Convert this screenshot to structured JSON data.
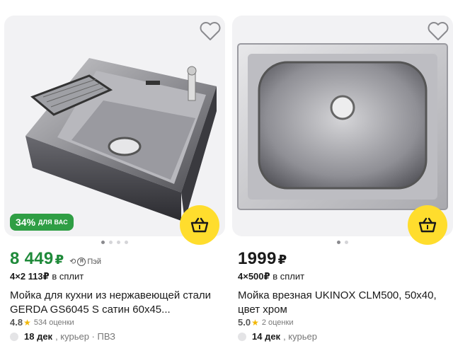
{
  "products": [
    {
      "discount_pct": "34%",
      "discount_tag": "ДЛЯ ВАС",
      "price": "8 449",
      "currency": "₽",
      "pay_label": "Пэй",
      "pay_ring": "Я",
      "split_times": "4×2 113",
      "split_currency": "₽",
      "split_label": "в сплит",
      "title": "Мойка для кухни из нержавеющей стали GERDA GS6045 S сатин 60х45...",
      "rating": "4.8",
      "rating_count": "534 оценки",
      "delivery_date": "18 дек",
      "delivery_method": ", курьер · ПВЗ",
      "image_icon": "steel-sink-with-tray-image",
      "dots": 4,
      "active_dot": 0
    },
    {
      "price": "1999",
      "currency": "₽",
      "split_times": "4×500",
      "split_currency": "₽",
      "split_label": "в сплит",
      "title": "Мойка врезная UKINOX CLM500, 50х40, цвет хром",
      "rating": "5.0",
      "rating_count": "2 оценки",
      "delivery_date": "14 дек",
      "delivery_method": ", курьер",
      "image_icon": "inset-sink-image",
      "dots": 2,
      "active_dot": 0
    }
  ],
  "colors": {
    "accent_green": "#1f8a3a",
    "badge_green": "#2f9e44",
    "cart_yellow": "#ffdd2d",
    "star": "#f2b705"
  }
}
